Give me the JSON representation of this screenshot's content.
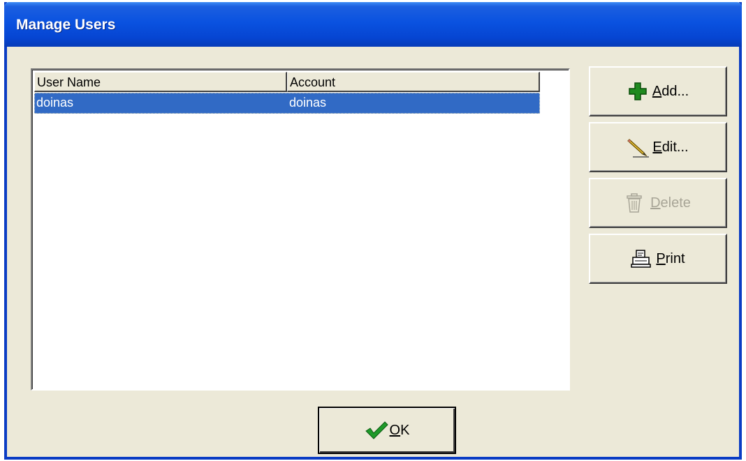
{
  "window": {
    "title": "Manage Users",
    "colors": {
      "title_bar": "#0a52e0",
      "selection": "#316ac5",
      "face": "#ece9d8"
    }
  },
  "list": {
    "columns": [
      "User Name",
      "Account"
    ],
    "rows": [
      {
        "user_name": "doinas",
        "account": "doinas",
        "selected": true
      }
    ]
  },
  "buttons": {
    "add": {
      "label_prefix": "",
      "mnemonic": "A",
      "label_rest": "dd...",
      "icon": "plus-icon",
      "enabled": true
    },
    "edit": {
      "label_prefix": "",
      "mnemonic": "E",
      "label_rest": "dit...",
      "icon": "pencil-icon",
      "enabled": true
    },
    "delete": {
      "label_prefix": "",
      "mnemonic": "D",
      "label_rest": "elete",
      "icon": "trash-icon",
      "enabled": false
    },
    "print": {
      "label_prefix": "",
      "mnemonic": "P",
      "label_rest": "rint",
      "icon": "printer-icon",
      "enabled": true
    },
    "ok": {
      "label_prefix": "",
      "mnemonic": "O",
      "label_rest": "K",
      "icon": "checkmark-icon",
      "enabled": true
    }
  }
}
